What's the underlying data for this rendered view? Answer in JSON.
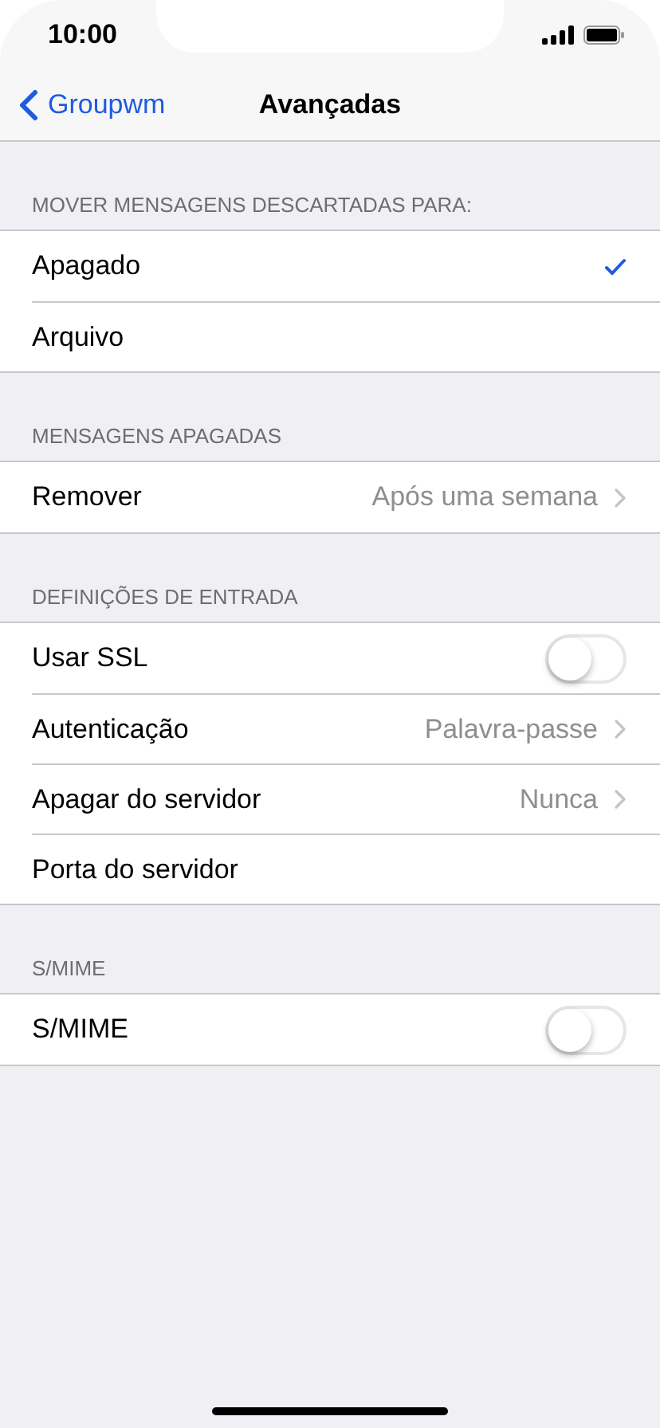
{
  "status_bar": {
    "time": "10:00"
  },
  "nav": {
    "back": "Groupwm",
    "title": "Avançadas"
  },
  "sections": [
    {
      "header": "MOVER MENSAGENS DESCARTADAS PARA:",
      "rows": [
        {
          "kind": "option",
          "label": "Apagado",
          "selected": true
        },
        {
          "kind": "option",
          "label": "Arquivo",
          "selected": false
        }
      ]
    },
    {
      "header": "MENSAGENS APAGADAS",
      "rows": [
        {
          "kind": "detail",
          "label": "Remover",
          "value": "Após uma semana"
        }
      ]
    },
    {
      "header": "DEFINIÇÕES DE ENTRADA",
      "rows": [
        {
          "kind": "switch",
          "label": "Usar SSL",
          "on": false
        },
        {
          "kind": "detail",
          "label": "Autenticação",
          "value": "Palavra-passe"
        },
        {
          "kind": "detail",
          "label": "Apagar do servidor",
          "value": "Nunca"
        },
        {
          "kind": "plain",
          "label": "Porta do servidor"
        }
      ]
    },
    {
      "header": "S/MIME",
      "rows": [
        {
          "kind": "switch",
          "label": "S/MIME",
          "on": false
        }
      ]
    }
  ]
}
